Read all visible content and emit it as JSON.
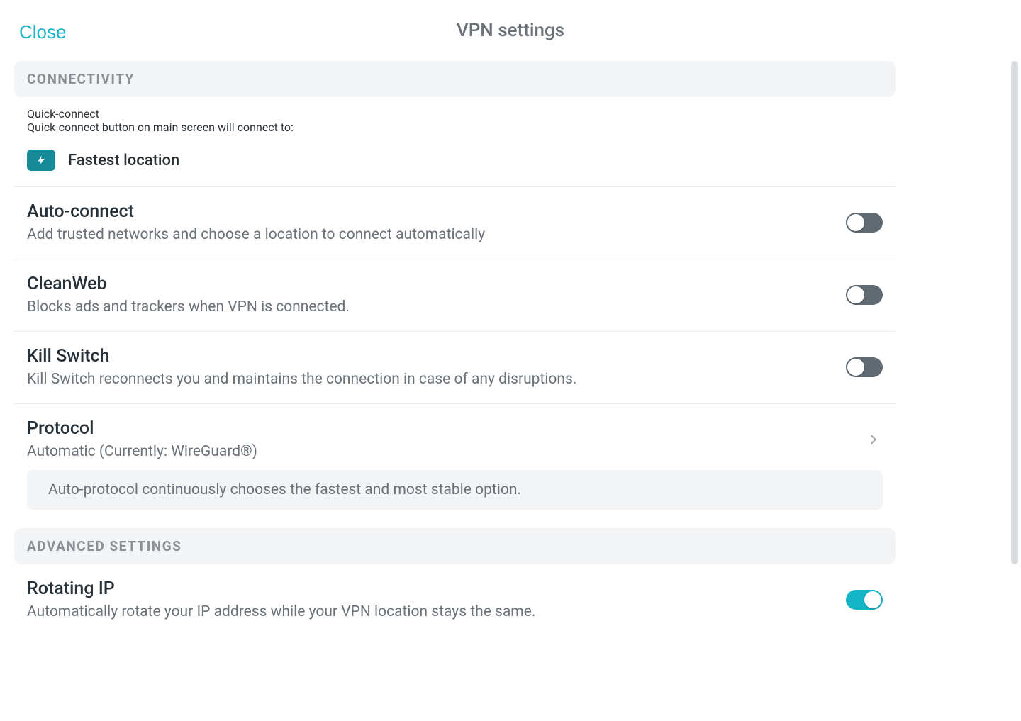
{
  "header": {
    "close_label": "Close",
    "title": "VPN settings"
  },
  "sections": {
    "connectivity": {
      "header": "CONNECTIVITY",
      "quick_connect": {
        "title": "Quick-connect",
        "subtitle": "Quick-connect button on main screen will connect to:",
        "selection_label": "Fastest location"
      },
      "auto_connect": {
        "title": "Auto-connect",
        "subtitle": "Add trusted networks and choose a location to connect automatically",
        "enabled": false
      },
      "cleanweb": {
        "title": "CleanWeb",
        "subtitle": "Blocks ads and trackers when VPN is connected.",
        "enabled": false
      },
      "kill_switch": {
        "title": "Kill Switch",
        "subtitle": "Kill Switch reconnects you and maintains the connection in case of any disruptions.",
        "enabled": false
      },
      "protocol": {
        "title": "Protocol",
        "subtitle": "Automatic (Currently: WireGuard®)",
        "note": "Auto-protocol continuously chooses the fastest and most stable option."
      }
    },
    "advanced": {
      "header": "ADVANCED SETTINGS",
      "rotating_ip": {
        "title": "Rotating IP",
        "subtitle": "Automatically rotate your IP address while your VPN location stays the same.",
        "enabled": true
      }
    }
  },
  "colors": {
    "accent": "#13b5c7",
    "badge": "#178a99",
    "toggle_off": "#5f6a73",
    "section_bg": "#f3f4f6",
    "text_muted": "#6a7178"
  }
}
